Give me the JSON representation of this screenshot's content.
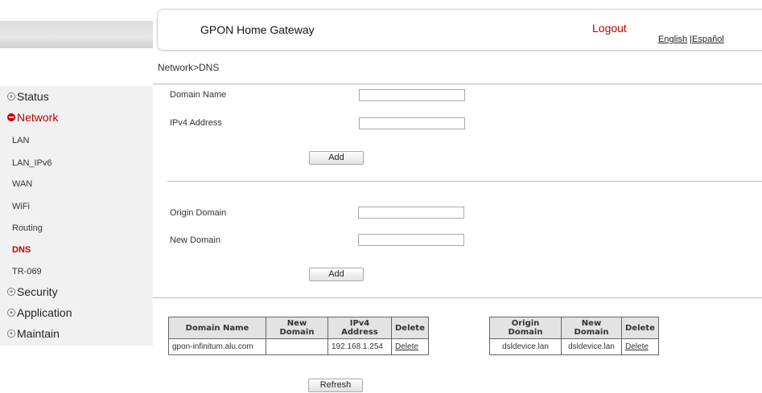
{
  "header": {
    "title": "GPON Home Gateway",
    "logout": "Logout",
    "lang_english": "English",
    "lang_sep": " |",
    "lang_spanish": "Español"
  },
  "breadcrumb": "Network>DNS",
  "sidebar": {
    "status": "Status",
    "network": "Network",
    "network_items": [
      "LAN",
      "LAN_IPv6",
      "WAN",
      "WiFi",
      "Routing",
      "DNS",
      "TR-069"
    ],
    "security": "Security",
    "application": "Application",
    "maintain": "Maintain"
  },
  "form1": {
    "domain_name_label": "Domain Name",
    "domain_name_value": "",
    "ipv4_label": "IPv4 Address",
    "ipv4_value": "",
    "add": "Add"
  },
  "form2": {
    "origin_label": "Origin Domain",
    "origin_value": "",
    "new_label": "New Domain",
    "new_value": "",
    "add": "Add"
  },
  "table1": {
    "headers": [
      "Domain Name",
      "New Domain",
      "IPv4 Address",
      "Delete"
    ],
    "rows": [
      [
        "gpon-infinitum.alu.com",
        "",
        "192.168.1.254",
        "Delete"
      ]
    ]
  },
  "table2": {
    "headers": [
      "Origin Domain",
      "New Domain",
      "Delete"
    ],
    "rows": [
      [
        "dsldevice.lan",
        "dsldevice.lan",
        "Delete"
      ]
    ]
  },
  "refresh": "Refresh",
  "colors": {
    "accent": "#c00000",
    "sidebar_bg": "#f1f1f1"
  }
}
